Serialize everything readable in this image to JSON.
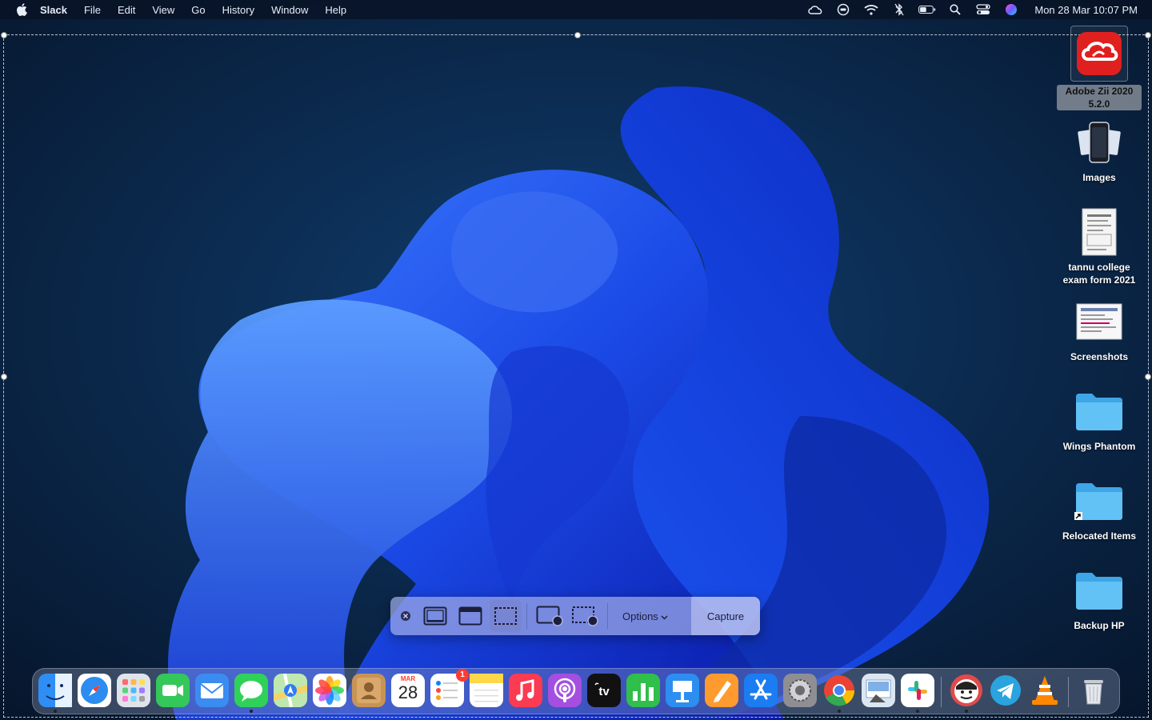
{
  "menubar": {
    "app_name": "Slack",
    "menus": [
      "File",
      "Edit",
      "View",
      "Go",
      "History",
      "Window",
      "Help"
    ],
    "status_icons": [
      "creative-cloud-icon",
      "vpn-icon",
      "wifi-icon",
      "bluetooth-icon",
      "battery-icon",
      "spotlight-icon",
      "control-center-icon",
      "siri-icon"
    ],
    "clock": "Mon 28 Mar  10:07 PM"
  },
  "desktop": {
    "items": [
      {
        "label": "Adobe Zii 2020 5.2.0",
        "icon": "adobe-cc-icon",
        "selected": true
      },
      {
        "label": "Images",
        "icon": "images-thumbnail-icon"
      },
      {
        "label": "tannu college exam form 2021",
        "icon": "document-thumbnail-icon"
      },
      {
        "label": "Screenshots",
        "icon": "screenshot-thumbnail-icon"
      },
      {
        "label": "Wings Phantom",
        "icon": "folder-icon"
      },
      {
        "label": "Relocated Items",
        "icon": "folder-alias-icon"
      },
      {
        "label": "Backup HP",
        "icon": "folder-icon"
      }
    ]
  },
  "capture_toolbar": {
    "tools": [
      "close-icon",
      "capture-entire-screen-icon",
      "capture-window-icon",
      "capture-selection-icon",
      "record-screen-icon",
      "record-selection-icon"
    ],
    "active_tool": "capture-selection-icon",
    "options_label": "Options",
    "capture_label": "Capture"
  },
  "dock": {
    "apps": [
      {
        "name": "finder",
        "color": "#2f8ef5",
        "running": true
      },
      {
        "name": "safari",
        "color": "#e8f2ff"
      },
      {
        "name": "launchpad",
        "color": "#dfe3ea"
      },
      {
        "name": "facetime",
        "color": "#34c759"
      },
      {
        "name": "mail",
        "color": "#3b8cf0"
      },
      {
        "name": "messages",
        "color": "#30d158",
        "running": true
      },
      {
        "name": "maps",
        "color": "#6fcf7a"
      },
      {
        "name": "photos",
        "color": "#ffffff"
      },
      {
        "name": "contacts",
        "color": "#c79455"
      },
      {
        "name": "calendar",
        "color": "#ffffff",
        "month": "MAR",
        "day": "28"
      },
      {
        "name": "reminders",
        "color": "#ffffff",
        "badge": "1"
      },
      {
        "name": "notes",
        "color": "#ffd84a"
      },
      {
        "name": "music",
        "color": "#fa3b52"
      },
      {
        "name": "podcasts",
        "color": "#a54fe0"
      },
      {
        "name": "apple-tv",
        "color": "#111111",
        "label": "tv"
      },
      {
        "name": "numbers",
        "color": "#2fbf4a"
      },
      {
        "name": "keynote",
        "color": "#2c8ef0"
      },
      {
        "name": "pages",
        "color": "#ff9a2e"
      },
      {
        "name": "app-store",
        "color": "#1c7cf2"
      },
      {
        "name": "system-preferences",
        "color": "#8e8e93"
      },
      {
        "name": "chrome",
        "color": "#ffffff",
        "running": true
      },
      {
        "name": "preview",
        "color": "#dbe6f3"
      },
      {
        "name": "slack",
        "color": "#ffffff",
        "running": true
      },
      {
        "name": "mole-app",
        "color": "#222222",
        "running": true
      },
      {
        "name": "telegram",
        "color": "#2aa3df"
      },
      {
        "name": "vlc",
        "color": "#ff8800"
      },
      {
        "name": "trash",
        "color": "#d7dbe0"
      }
    ]
  }
}
